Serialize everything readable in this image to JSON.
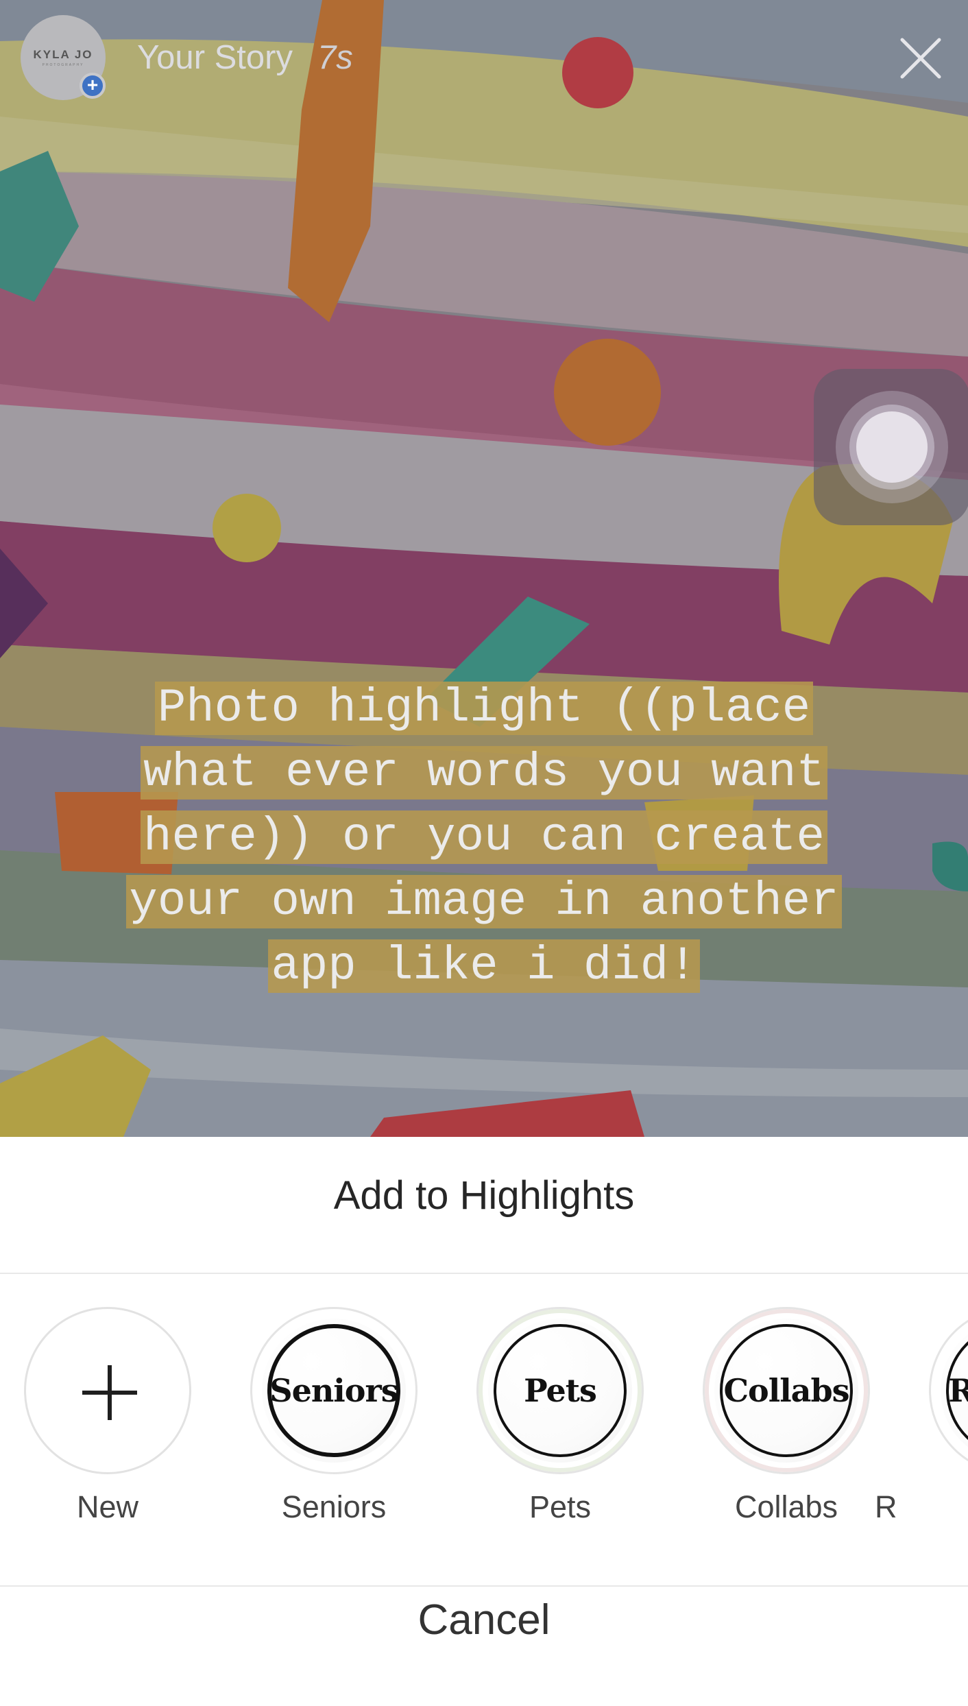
{
  "story": {
    "account_label": "KYLA JO",
    "account_sublabel": "PHOTOGRAPHY",
    "title": "Your Story",
    "time": "7s",
    "caption_lines": [
      "Photo highlight ((place",
      "what ever words you want",
      "here)) or you can create",
      "your own image in another",
      "app like i did!"
    ]
  },
  "sheet": {
    "title": "Add to Highlights",
    "new_label": "New",
    "highlights": [
      {
        "cover_text": "Seniors",
        "label": "Seniors"
      },
      {
        "cover_text": "Pets",
        "label": "Pets"
      },
      {
        "cover_text": "Collabs",
        "label": "Collabs"
      },
      {
        "cover_text": "R",
        "label": "R"
      }
    ],
    "cancel_label": "Cancel"
  }
}
